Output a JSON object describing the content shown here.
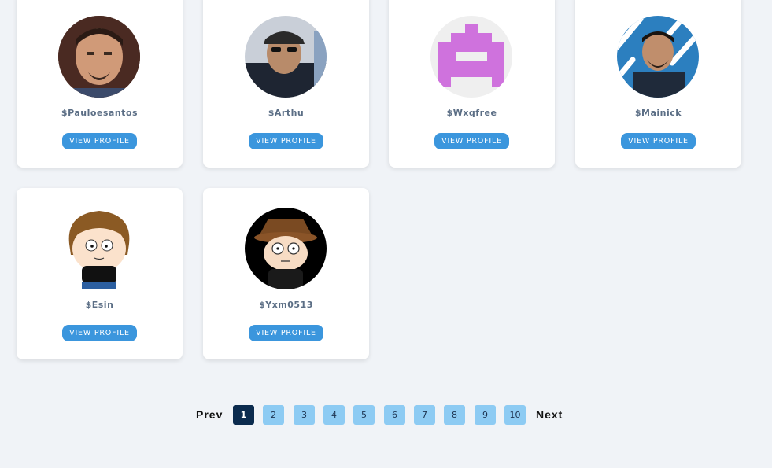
{
  "profiles": [
    {
      "cashtag": "$Pauloesantos",
      "button_label": "VIEW PROFILE"
    },
    {
      "cashtag": "$Arthu",
      "button_label": "VIEW PROFILE"
    },
    {
      "cashtag": "$Wxqfree",
      "button_label": "VIEW PROFILE"
    },
    {
      "cashtag": "$Mainick",
      "button_label": "VIEW PROFILE"
    },
    {
      "cashtag": "$Esin",
      "button_label": "VIEW PROFILE"
    },
    {
      "cashtag": "$Yxm0513",
      "button_label": "VIEW PROFILE"
    }
  ],
  "pagination": {
    "prev_label": "Prev",
    "next_label": "Next",
    "pages": [
      "1",
      "2",
      "3",
      "4",
      "5",
      "6",
      "7",
      "8",
      "9",
      "10"
    ],
    "current": "1"
  },
  "colors": {
    "background": "#f0f3f7",
    "button": "#3b96dd",
    "page_active": "#0b2b4e",
    "page_inactive": "#8dcbf3"
  }
}
